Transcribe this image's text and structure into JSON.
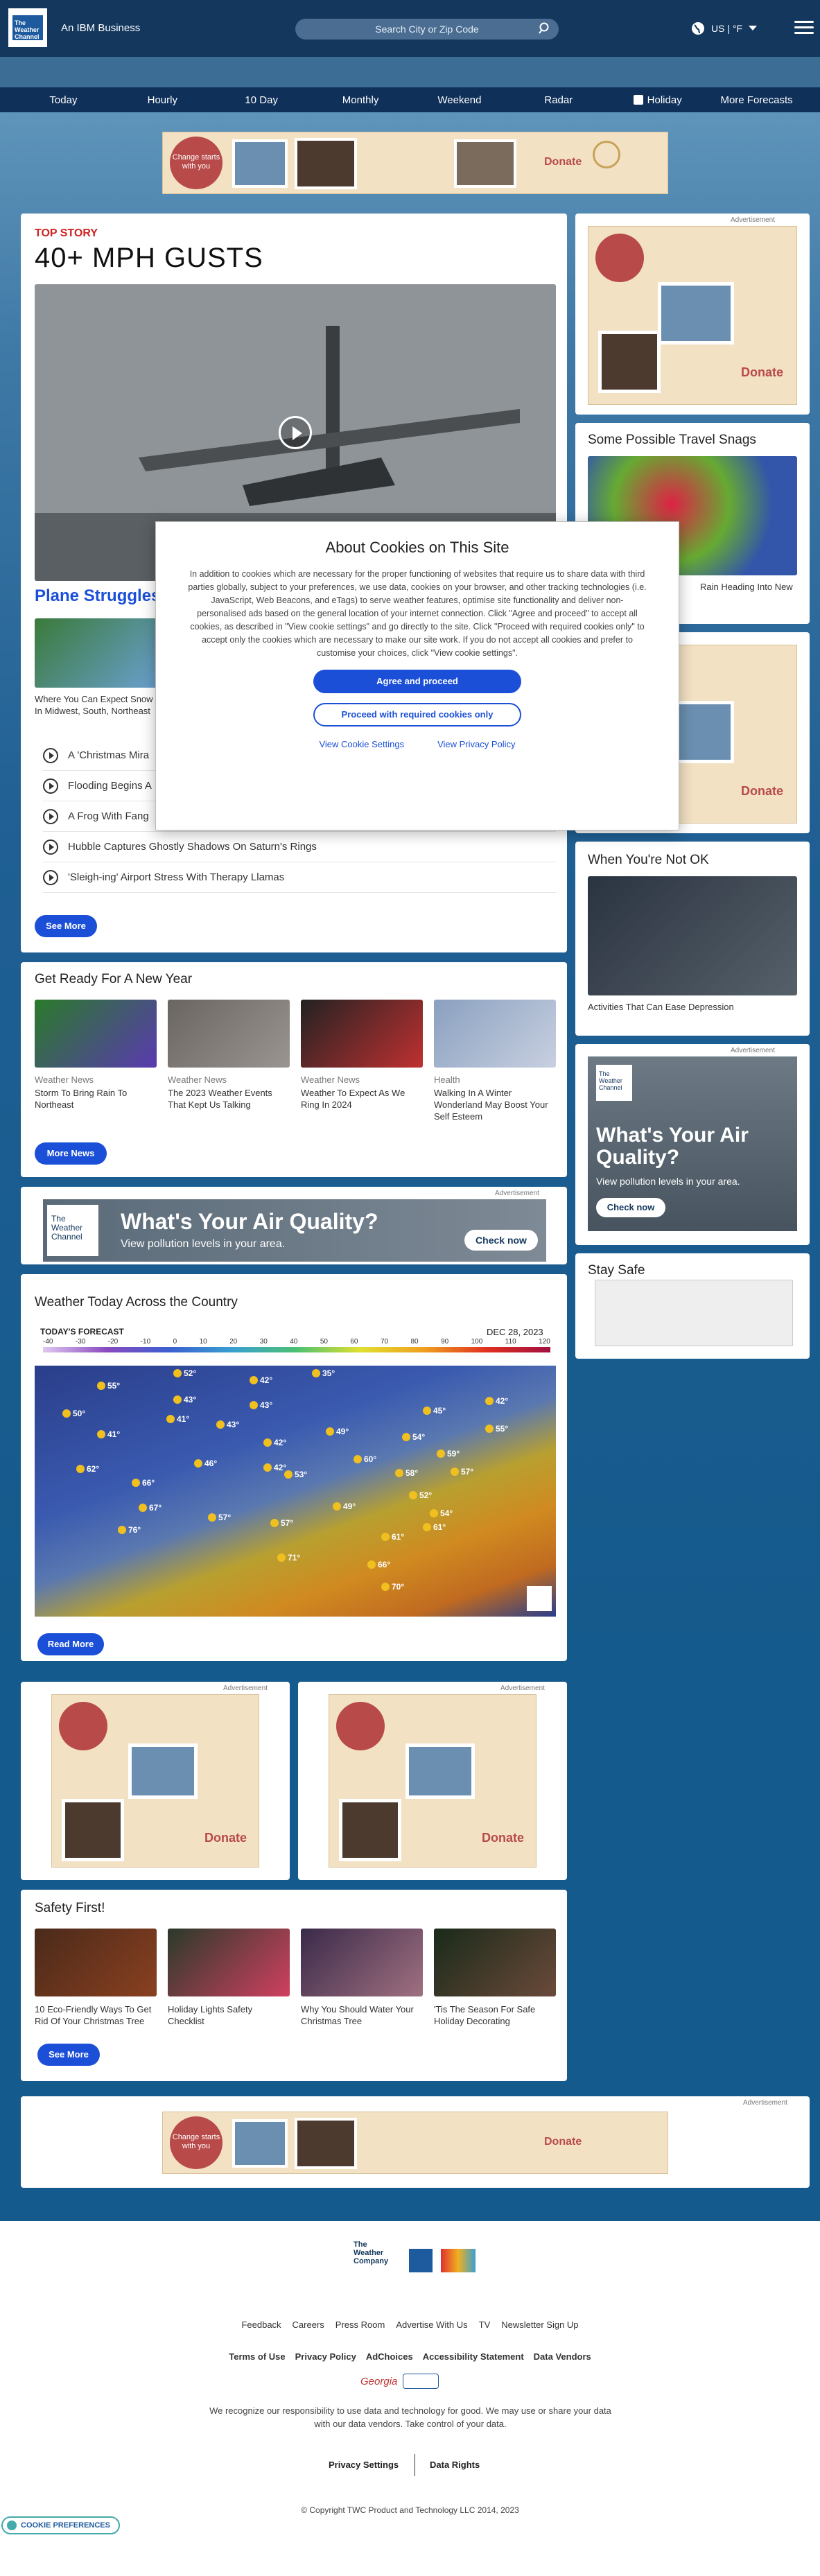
{
  "header": {
    "logo_text": "The Weather Channel",
    "ibm": "An IBM Business",
    "search_placeholder": "Search City or Zip Code",
    "units": "US | °F"
  },
  "nav": [
    "Today",
    "Hourly",
    "10 Day",
    "Monthly",
    "Weekend",
    "Radar",
    "Holiday",
    "More Forecasts"
  ],
  "ads": {
    "label": "Advertisement",
    "charity_text": "Change starts with you",
    "donate": "Donate"
  },
  "top_story": {
    "tag": "TOP STORY",
    "headline": "40+ MPH GUSTS",
    "sub_headline": "Plane Struggles",
    "card_text": "Where You Can Expect Snow In Midwest, South, Northeast",
    "list": [
      "A 'Christmas Mira",
      "Flooding Begins A",
      "A Frog With Fang",
      "Hubble Captures Ghostly Shadows On Saturn's Rings",
      "'Sleigh-ing' Airport Stress With Therapy Llamas"
    ],
    "see_more": "See More"
  },
  "sidebar": {
    "travel_title": "Some Possible Travel Snags",
    "travel_caption": "Rain Heading Into New",
    "notok_title": "When You're Not OK",
    "notok_caption": "Activities That Can Ease Depression",
    "air_title": "What's Your Air Quality?",
    "air_sub": "View pollution levels in your area.",
    "air_btn": "Check now",
    "stay_safe": "Stay Safe"
  },
  "new_year": {
    "title": "Get Ready For A New Year",
    "items": [
      {
        "cat": "Weather News",
        "title": "Storm To Bring Rain To Northeast"
      },
      {
        "cat": "Weather News",
        "title": "The 2023 Weather Events That Kept Us Talking"
      },
      {
        "cat": "Weather News",
        "title": "Weather To Expect As We Ring In 2024"
      },
      {
        "cat": "Health",
        "title": "Walking In A Winter Wonderland May Boost Your Self Esteem"
      }
    ],
    "more": "More News"
  },
  "air_banner": {
    "title": "What's Your Air Quality?",
    "sub": "View pollution levels in your area.",
    "btn": "Check now"
  },
  "map": {
    "title": "Weather Today Across the Country",
    "forecast": "TODAY'S FORECAST",
    "date": "DEC 28, 2023",
    "scale": [
      "-40",
      "-30",
      "-20",
      "-10",
      "0",
      "10",
      "20",
      "30",
      "40",
      "50",
      "60",
      "70",
      "80",
      "90",
      "100",
      "110",
      "120"
    ],
    "temps": [
      "52°",
      "55°",
      "42°",
      "35°",
      "43°",
      "43°",
      "45°",
      "42°",
      "50°",
      "41°",
      "43°",
      "49°",
      "41°",
      "54°",
      "42°",
      "55°",
      "46°",
      "62°",
      "42°",
      "59°",
      "60°",
      "57°",
      "66°",
      "53°",
      "49°",
      "58°",
      "52°",
      "54°",
      "67°",
      "57°",
      "57°",
      "61°",
      "61°",
      "66°",
      "71°",
      "70°",
      "76°"
    ],
    "read_more": "Read More"
  },
  "safety": {
    "title": "Safety First!",
    "items": [
      "10 Eco-Friendly Ways To Get Rid Of Your Christmas Tree",
      "Holiday Lights Safety Checklist",
      "Why You Should Water Your Christmas Tree",
      "'Tis The Season For Safe Holiday Decorating"
    ],
    "more": "See More"
  },
  "cookie": {
    "title": "About Cookies on This Site",
    "body": "In addition to cookies which are necessary for the proper functioning of websites that require us to share data with third parties globally, subject to your preferences, we use data, cookies on your browser, and other tracking technologies (i.e. JavaScript, Web Beacons, and eTags) to serve weather features, optimise site functionality and deliver non-personalised ads based on the general location of your internet connection. Click \"Agree and proceed\" to accept all cookies, as described in \"View cookie settings\" and go directly to the site. Click \"Proceed with required cookies only\" to accept only the cookies which are necessary to make our site work. If you do not accept all cookies and prefer to customise your choices, click \"View cookie settings\".",
    "agree": "Agree and proceed",
    "required": "Proceed with required cookies only",
    "settings": "View Cookie Settings",
    "privacy": "View Privacy Policy"
  },
  "footer": {
    "brand": "The Weather Company",
    "brand_sub": "An IBM Business",
    "links1": [
      "Feedback",
      "Careers",
      "Press Room",
      "Advertise With Us",
      "TV",
      "Newsletter Sign Up"
    ],
    "links2": [
      "Terms of Use",
      "Privacy Policy",
      "AdChoices",
      "Accessibility Statement",
      "Data Vendors"
    ],
    "georgia": "Georgia",
    "responsibility": "We recognize our responsibility to use data and technology for good. We may use or share your data with our data vendors. Take control of your data.",
    "privacy_settings": "Privacy Settings",
    "data_rights": "Data Rights",
    "copyright": "© Copyright TWC Product and Technology LLC 2014, 2023",
    "cookie_prefs": "COOKIE PREFERENCES"
  }
}
